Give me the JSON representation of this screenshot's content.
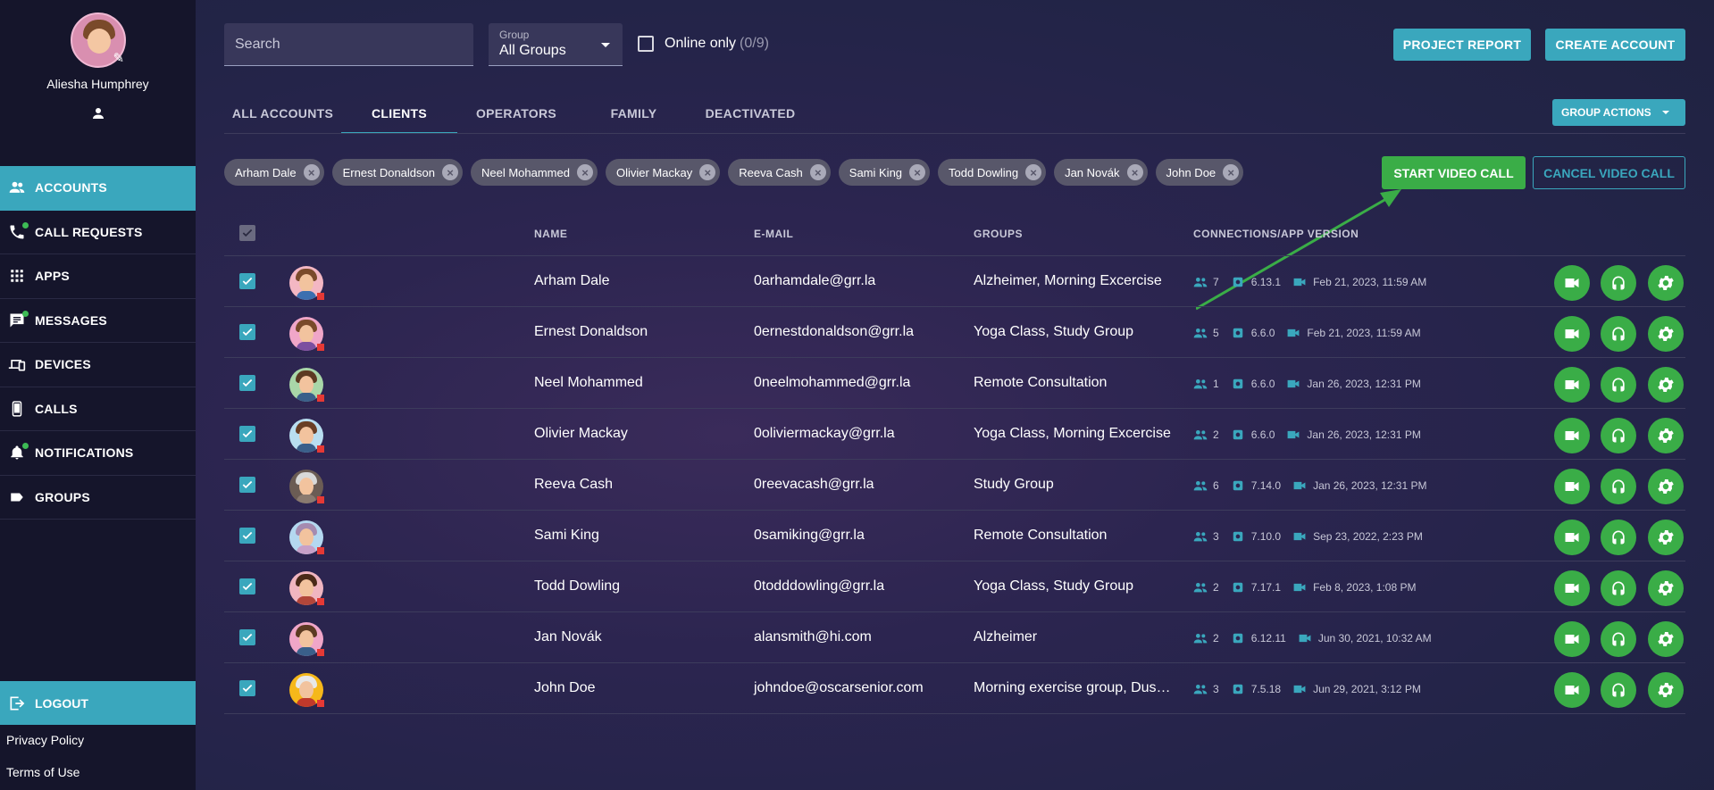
{
  "sidebar": {
    "user_name": "Aliesha Humphrey",
    "nav": [
      {
        "label": "ACCOUNTS",
        "icon": "people-icon",
        "active": true,
        "dot": false
      },
      {
        "label": "CALL REQUESTS",
        "icon": "phone-icon",
        "active": false,
        "dot": true
      },
      {
        "label": "APPS",
        "icon": "apps-grid-icon",
        "active": false,
        "dot": false
      },
      {
        "label": "MESSAGES",
        "icon": "message-icon",
        "active": false,
        "dot": true
      },
      {
        "label": "DEVICES",
        "icon": "devices-icon",
        "active": false,
        "dot": false
      },
      {
        "label": "CALLS",
        "icon": "mobile-icon",
        "active": false,
        "dot": false
      },
      {
        "label": "NOTIFICATIONS",
        "icon": "bell-icon",
        "active": false,
        "dot": true
      },
      {
        "label": "GROUPS",
        "icon": "label-icon",
        "active": false,
        "dot": false
      }
    ],
    "logout": "LOGOUT",
    "privacy": "Privacy Policy",
    "terms": "Terms of Use"
  },
  "toolbar": {
    "search_placeholder": "Search",
    "group_label": "Group",
    "group_value": "All Groups",
    "online_label": "Online only",
    "online_count": "(0/9)",
    "project_report": "PROJECT REPORT",
    "create_account": "CREATE ACCOUNT"
  },
  "tabs": [
    "ALL ACCOUNTS",
    "CLIENTS",
    "OPERATORS",
    "FAMILY",
    "DEACTIVATED"
  ],
  "active_tab": "CLIENTS",
  "group_actions": "GROUP ACTIONS",
  "chips": [
    "Arham Dale",
    "Ernest Donaldson",
    "Neel Mohammed",
    "Olivier Mackay",
    "Reeva Cash",
    "Sami King",
    "Todd Dowling",
    "Jan Novák",
    "John Doe"
  ],
  "start_video_call": "START VIDEO CALL",
  "cancel_video_call": "CANCEL VIDEO CALL",
  "table": {
    "headers": {
      "name": "NAME",
      "email": "E-MAIL",
      "groups": "GROUPS",
      "connections": "CONNECTIONS/APP VERSION"
    },
    "rows": [
      {
        "name": "Arham Dale",
        "email": "0arhamdale@grr.la",
        "groups": "Alzheimer, Morning Excercise",
        "connections": "7",
        "version": "6.13.1",
        "last_call": "Feb 21, 2023, 11:59 AM"
      },
      {
        "name": "Ernest Donaldson",
        "email": "0ernestdonaldson@grr.la",
        "groups": "Yoga Class, Study Group",
        "connections": "5",
        "version": "6.6.0",
        "last_call": "Feb 21, 2023, 11:59 AM"
      },
      {
        "name": "Neel Mohammed",
        "email": "0neelmohammed@grr.la",
        "groups": "Remote Consultation",
        "connections": "1",
        "version": "6.6.0",
        "last_call": "Jan 26, 2023, 12:31 PM"
      },
      {
        "name": "Olivier Mackay",
        "email": "0oliviermackay@grr.la",
        "groups": "Yoga Class, Morning Excercise",
        "connections": "2",
        "version": "6.6.0",
        "last_call": "Jan 26, 2023, 12:31 PM"
      },
      {
        "name": "Reeva Cash",
        "email": "0reevacash@grr.la",
        "groups": "Study Group",
        "connections": "6",
        "version": "7.14.0",
        "last_call": "Jan 26, 2023, 12:31 PM"
      },
      {
        "name": "Sami King",
        "email": "0samiking@grr.la",
        "groups": "Remote Consultation",
        "connections": "3",
        "version": "7.10.0",
        "last_call": "Sep 23, 2022, 2:23 PM"
      },
      {
        "name": "Todd Dowling",
        "email": "0todddowling@grr.la",
        "groups": "Yoga Class, Study Group",
        "connections": "2",
        "version": "7.17.1",
        "last_call": "Feb 8, 2023, 1:08 PM"
      },
      {
        "name": "Jan Novák",
        "email": "alansmith@hi.com",
        "groups": "Alzheimer",
        "connections": "2",
        "version": "6.12.11",
        "last_call": "Jun 30, 2021, 10:32 AM"
      },
      {
        "name": "John Doe",
        "email": "johndoe@oscarsenior.com",
        "groups": "Morning exercise group, Dusa…",
        "connections": "3",
        "version": "7.5.18",
        "last_call": "Jun 29, 2021, 3:12 PM"
      }
    ]
  },
  "colors": {
    "accent": "#3aa7bd",
    "green": "#3aad47",
    "sidebar": "#15152b"
  }
}
